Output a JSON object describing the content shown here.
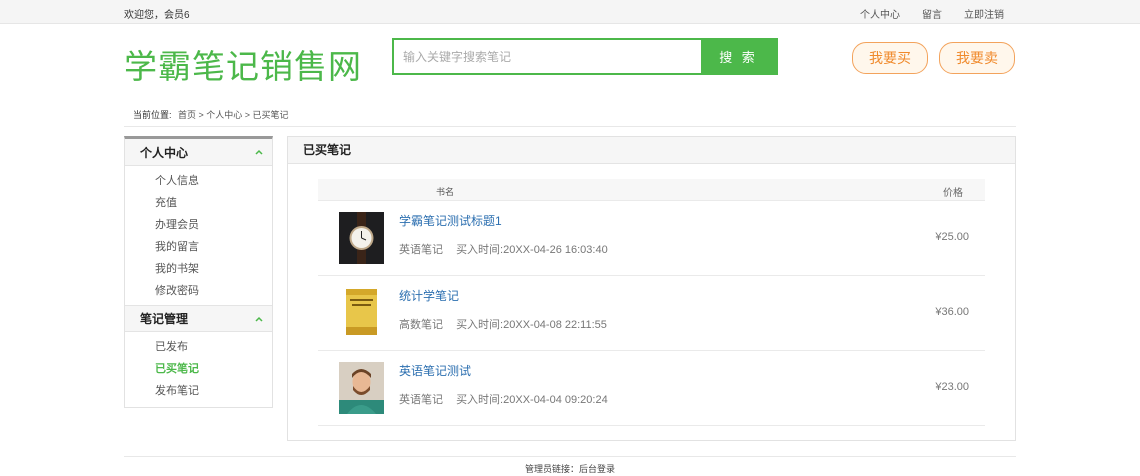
{
  "topbar": {
    "welcome": "欢迎您，会员6",
    "links": [
      "个人中心",
      "留言",
      "立即注销"
    ]
  },
  "header": {
    "logo": "学霸笔记销售网",
    "search_placeholder": "输入关键字搜索笔记",
    "search_button": "搜 索",
    "buy_button": "我要买",
    "sell_button": "我要卖"
  },
  "breadcrumb": {
    "label": "当前位置:",
    "path": "首页 > 个人中心 > 已买笔记"
  },
  "sidebar": {
    "section1": {
      "title": "个人中心",
      "items": [
        "个人信息",
        "充值",
        "办理会员",
        "我的留言",
        "我的书架",
        "修改密码"
      ]
    },
    "section2": {
      "title": "笔记管理",
      "items": [
        "已发布",
        "已买笔记",
        "发布笔记"
      ],
      "active": "已买笔记"
    }
  },
  "content": {
    "title": "已买笔记",
    "columns": {
      "name": "书名",
      "price": "价格"
    },
    "rows": [
      {
        "title": "学霸笔记测试标题1",
        "category": "英语笔记",
        "time": "买入时间:20XX-04-26 16:03:40",
        "price": "¥25.00",
        "thumb": "watch-image"
      },
      {
        "title": "统计学笔记",
        "category": "高数笔记",
        "time": "买入时间:20XX-04-08 22:11:55",
        "price": "¥36.00",
        "thumb": "book-cover-image"
      },
      {
        "title": "英语笔记测试",
        "category": "英语笔记",
        "time": "买入时间:20XX-04-04 09:20:24",
        "price": "¥23.00",
        "thumb": "portrait-image"
      }
    ]
  },
  "footer": {
    "text": "管理员链接：后台登录"
  },
  "colors": {
    "brand_green": "#4cb84a",
    "accent_orange": "#f08a2c",
    "link_blue": "#2c6fb0"
  }
}
